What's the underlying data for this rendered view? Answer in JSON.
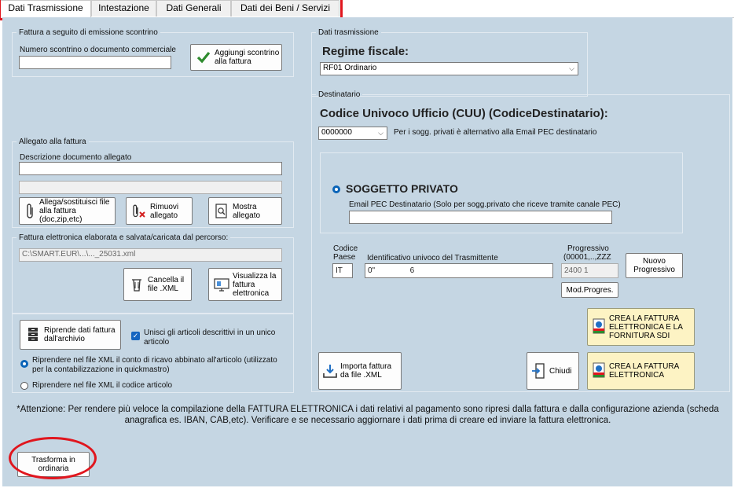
{
  "tabs": [
    {
      "label": "Dati Trasmissione",
      "active": true
    },
    {
      "label": "Intestazione",
      "active": false
    },
    {
      "label": "Dati Generali",
      "active": false
    },
    {
      "label": "Dati dei Beni / Servizi",
      "active": false
    }
  ],
  "scontrino": {
    "legend": "Fattura a seguito di emissione scontrino",
    "field_label": "Numero scontrino o documento commerciale",
    "field_value": "",
    "add_button": "Aggiungi scontrino alla fattura"
  },
  "allegato": {
    "legend": "Allegato alla fattura",
    "desc_label": "Descrizione documento allegato",
    "desc_value": "",
    "path_value": "",
    "attach_button": "Allega/sostituisci file alla fattura (doc,zip,etc)",
    "remove_button": "Rimuovi allegato",
    "show_button": "Mostra allegato"
  },
  "fattura_xml": {
    "legend": "Fattura elettronica elaborata e salvata/caricata dal percorso:",
    "path_value": "C:\\SMART.EUR\\...\\..._25031.xml",
    "delete_button": "Cancella il file .XML",
    "view_button": "Visualizza la fattura elettronica"
  },
  "opzioni": {
    "archive_button": "Riprende dati fattura dall'archivio",
    "merge_checkbox": "Unisci gli articoli descrittivi in un unico articolo",
    "radio_conto": "Riprendere nel file XML il  conto di ricavo abbinato all'articolo (utilizzato per la contabilizzazione in quickmastro)",
    "radio_codice": "Riprendere nel file XML il codice articolo"
  },
  "trasmissione": {
    "legend": "Dati trasmissione",
    "regime_title": "Regime fiscale:",
    "regime_value": "RF01 Ordinario"
  },
  "destinatario": {
    "legend": "Destinatario",
    "cuu_title": "Codice Univoco Ufficio (CUU) (CodiceDestinatario):",
    "cuu_value": "0000000",
    "cuu_note": "Per i sogg. privati è alternativo alla Email PEC destinatario",
    "soggetto_label": "SOGGETTO PRIVATO",
    "pec_label": "Email PEC Destinatario (Solo per sogg.privato che riceve tramite canale PEC)",
    "pec_value": ""
  },
  "trasmittente": {
    "codice_paese_label_1": "Codice",
    "codice_paese_label_2": "Paese",
    "codice_paese_value": "IT",
    "id_label": "Identificativo univoco del Trasmittente",
    "id_value": "0\"                6",
    "progressivo_label_1": "Progressivo",
    "progressivo_label_2": "(00001,..,ZZZ",
    "progressivo_value": "2400 1",
    "nuovo_button": "Nuovo Progressivo",
    "mod_button": "Mod.Progres."
  },
  "azioni": {
    "crea_sdi_button": "CREA LA FATTURA ELETTRONICA E LA FORNITURA SDI",
    "importa_button": "Importa fattura da file .XML",
    "chiudi_button": "Chiudi",
    "crea_button": "CREA LA FATTURA ELETTRONICA"
  },
  "attenzione": "*Attenzione: Per rendere più veloce la compilazione della FATTURA ELETTRONICA i dati relativi al pagamento sono ripresi dalla fattura e dalla configurazione azienda (scheda anagrafica es. IBAN, CAB,etc). Verificare e se necessario aggiornare i dati prima di creare ed inviare la fattura elettronica.",
  "trasforma_button": "Trasforma in ordinaria",
  "colors": {
    "panel_bg": "#c5d6e3",
    "highlight": "#e0161e",
    "yellow_button": "#fdf3c4",
    "radio_blue": "#0a64b8"
  }
}
